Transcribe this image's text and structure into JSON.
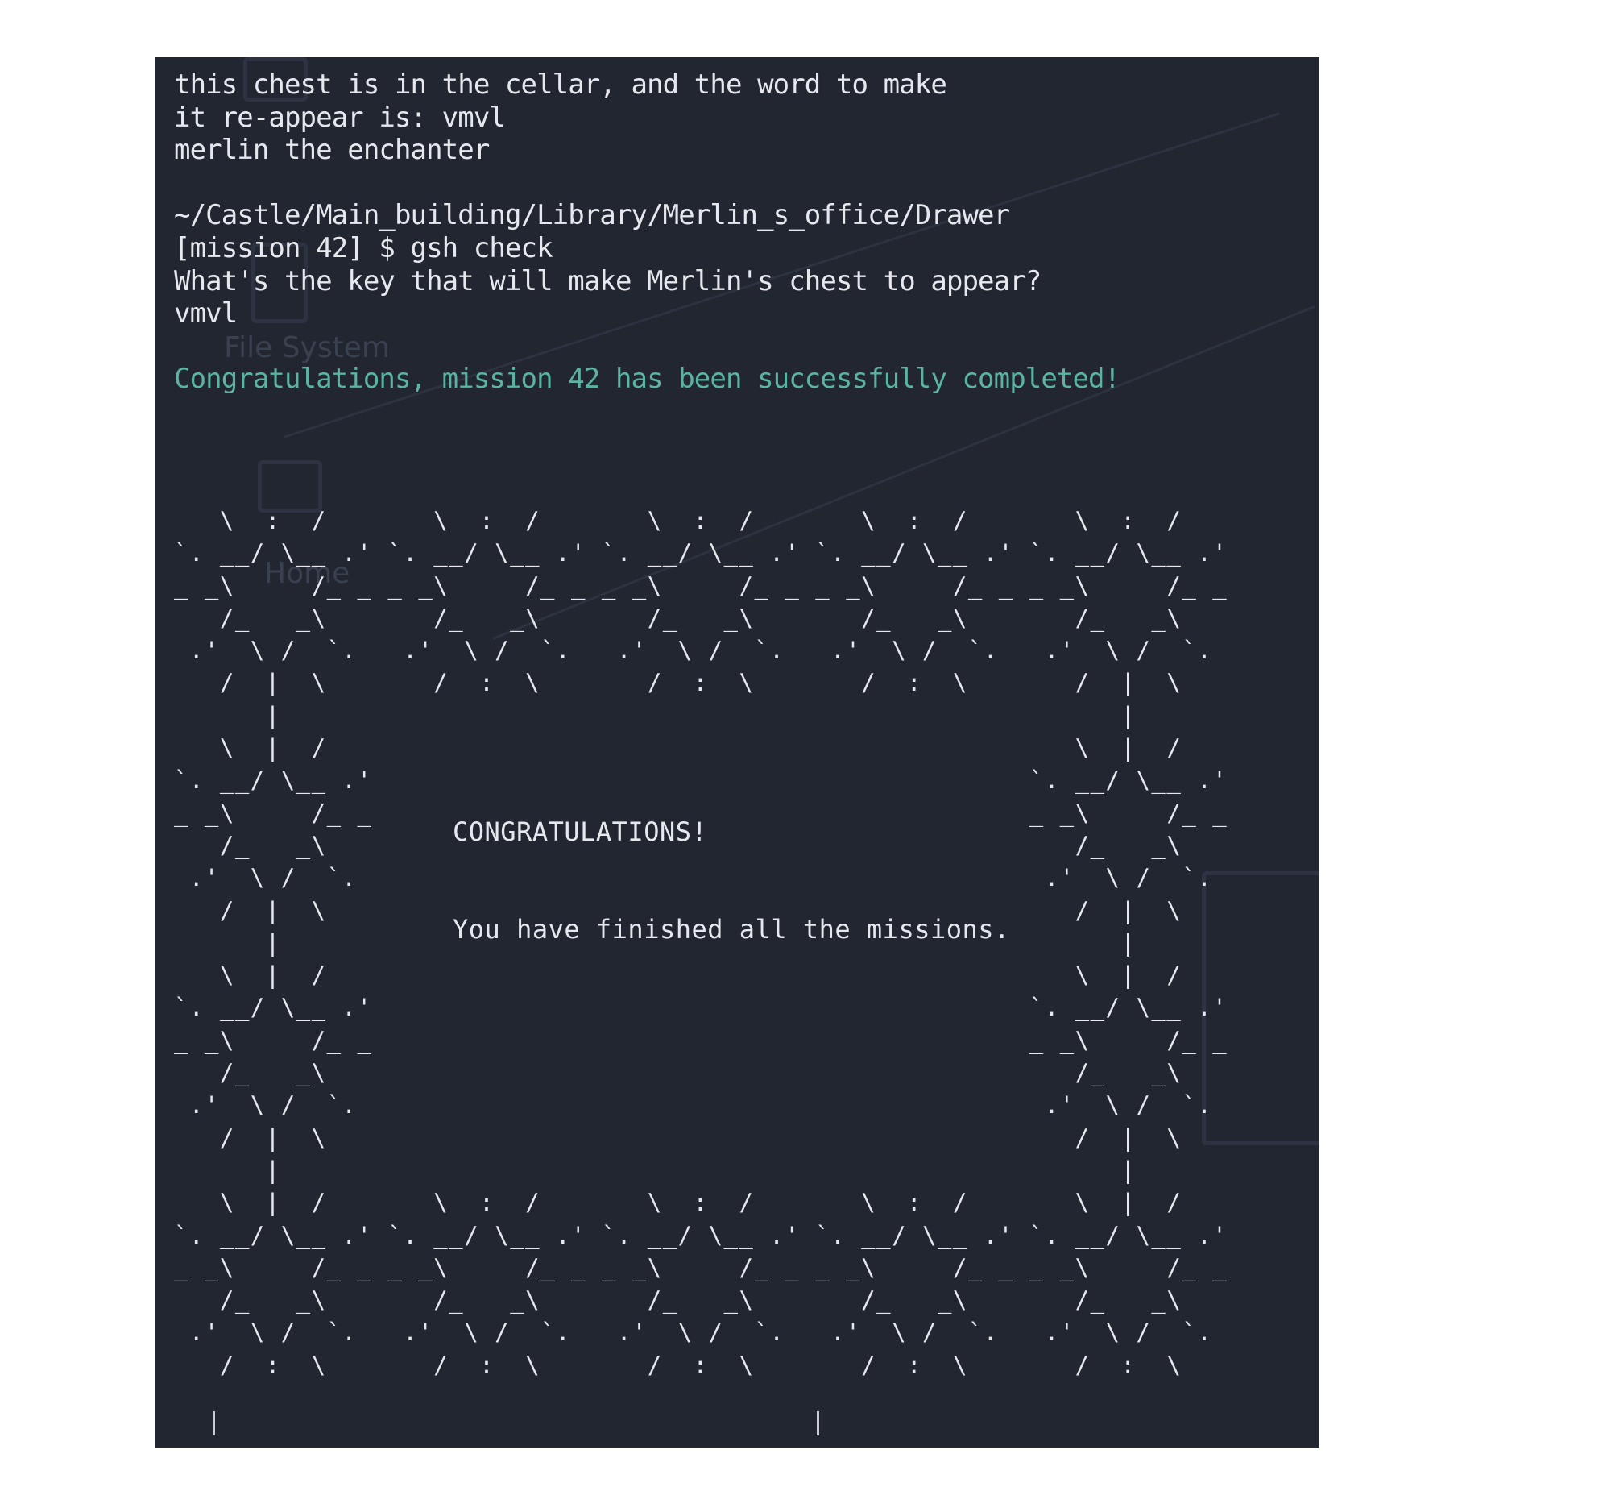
{
  "terminal": {
    "lines": [
      "this chest is in the cellar, and the word to make",
      "it re-appear is: vmvl",
      "merlin the enchanter",
      "",
      "~/Castle/Main_building/Library/Merlin_s_office/Drawer",
      "[mission 42] $ gsh check",
      "What's the key that will make Merlin's chest to appear?",
      "vmvl",
      ""
    ],
    "success": "Congratulations, mission 42 has been successfully completed!",
    "art_title": "CONGRATULATIONS!",
    "art_message": "You have finished all the missions.",
    "art": "   \\  :  /       \\  :  /       \\  :  /       \\  :  /       \\  :  /\n`. __/ \\__ .' `. __/ \\__ .' `. __/ \\__ .' `. __/ \\__ .' `. __/ \\__ .'\n_ _\\     /_ _ _ _\\     /_ _ _ _\\     /_ _ _ _\\     /_ _ _ _\\     /_ _\n   /_   _\\       /_   _\\       /_   _\\       /_   _\\       /_   _\\\n .'  \\ /  `.   .'  \\ /  `.   .'  \\ /  `.   .'  \\ /  `.   .'  \\ /  `.\n   /  |  \\       /  :  \\       /  :  \\       /  :  \\       /  |  \\\n      |                                                       |\n   \\  |  /                                                 \\  |  /\n`. __/ \\__ .'                                           `. __/ \\__ .'\n_ _\\     /_ _                                           _ _\\     /_ _\n   /_   _\\                                                 /_   _\\\n .'  \\ /  `.                                             .'  \\ /  `.\n   /  |  \\                                                 /  |  \\\n      |                                                       |\n   \\  |  /                                                 \\  |  /\n`. __/ \\__ .'                                           `. __/ \\__ .'\n_ _\\     /_ _                                           _ _\\     /_ _\n   /_   _\\                                                 /_   _\\\n .'  \\ /  `.                                             .'  \\ /  `.\n   /  |  \\                                                 /  |  \\\n      |                                                       |\n   \\  |  /       \\  :  /       \\  :  /       \\  :  /       \\  |  /\n`. __/ \\__ .' `. __/ \\__ .' `. __/ \\__ .' `. __/ \\__ .' `. __/ \\__ .'\n_ _\\     /_ _ _ _\\     /_ _ _ _\\     /_ _ _ _\\     /_ _ _ _\\     /_ _\n   /_   _\\       /_   _\\       /_   _\\       /_   _\\       /_   _\\\n .'  \\ /  `.   .'  \\ /  `.   .'  \\ /  `.   .'  \\ /  `.   .'  \\ /  `.\n   /  :  \\       /  :  \\       /  :  \\       /  :  \\       /  :  \\"
  },
  "wallpaper": {
    "labels": [
      "File System",
      "Home"
    ]
  },
  "colors": {
    "background": "#222631",
    "text": "#e6e8ee",
    "success": "#5bb3a1"
  }
}
